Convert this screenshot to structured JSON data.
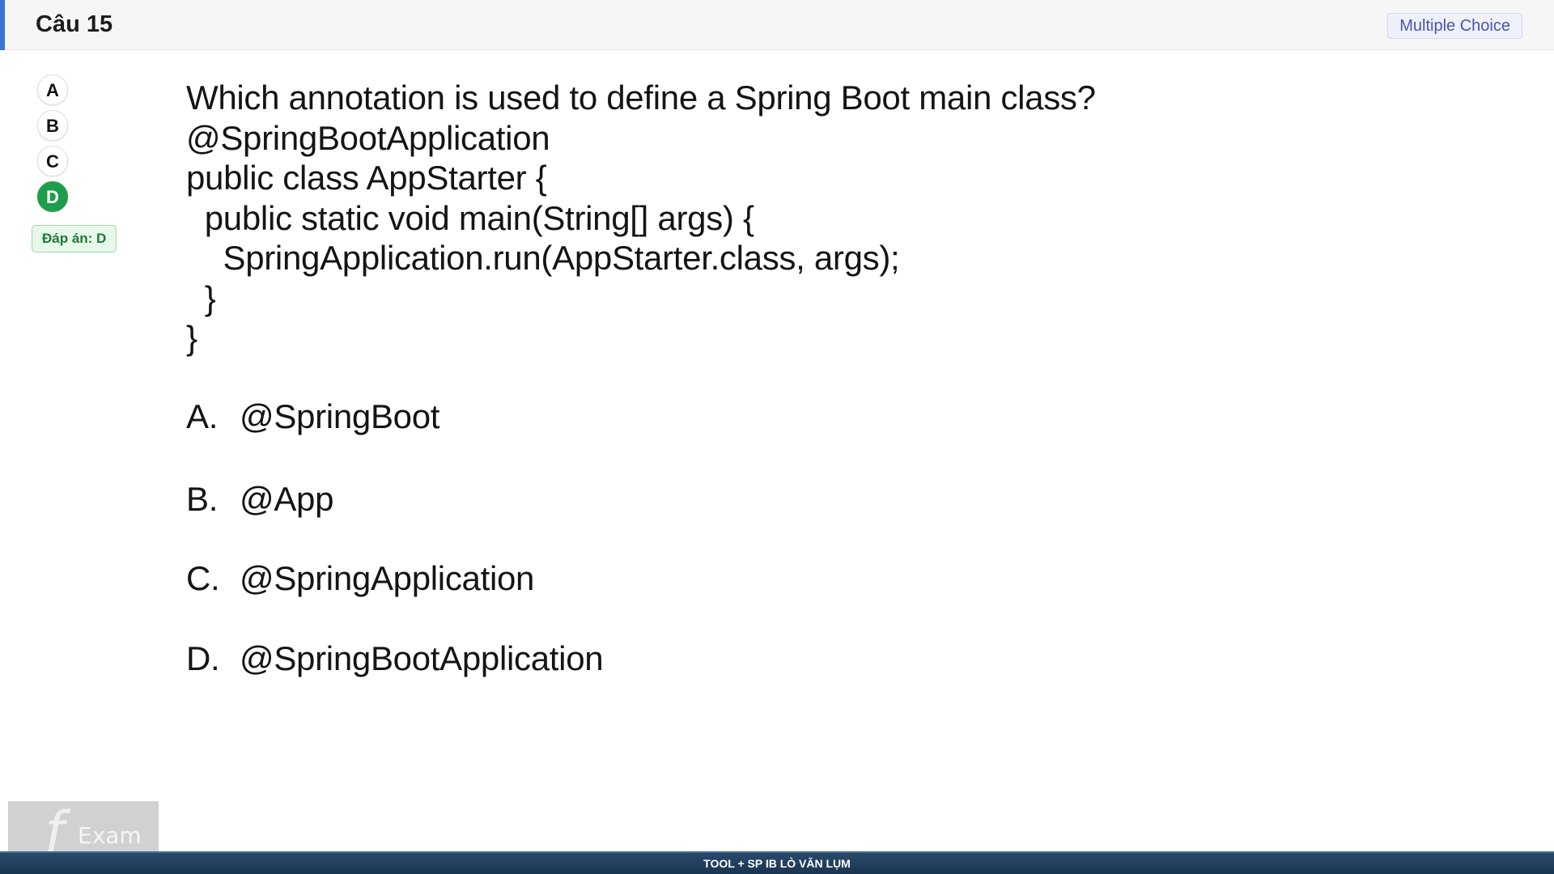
{
  "header": {
    "title": "Câu 15",
    "question_type": "Multiple Choice",
    "accent_color": "#3b73d9"
  },
  "options_selector": {
    "items": [
      "A",
      "B",
      "C",
      "D"
    ],
    "selected": "D",
    "selected_color": "#1e9e4a",
    "answer_label": "Đáp án: D"
  },
  "question": {
    "lines": [
      "Which annotation is used to define a Spring Boot main class?",
      "@SpringBootApplication",
      "public class AppStarter {",
      "  public static void main(String[] args) {",
      "    SpringApplication.run(AppStarter.class, args);",
      "  }",
      "}"
    ],
    "choices": [
      {
        "letter": "A.",
        "text": "@SpringBoot"
      },
      {
        "letter": "B.",
        "text": "@App"
      },
      {
        "letter": "C.",
        "text": "@SpringApplication"
      },
      {
        "letter": "D.",
        "text": "@SpringBootApplication"
      }
    ]
  },
  "watermark": {
    "logo_text": "Exam"
  },
  "footer": {
    "text": "TOOL + SP IB LÒ VĂN LỤM"
  }
}
